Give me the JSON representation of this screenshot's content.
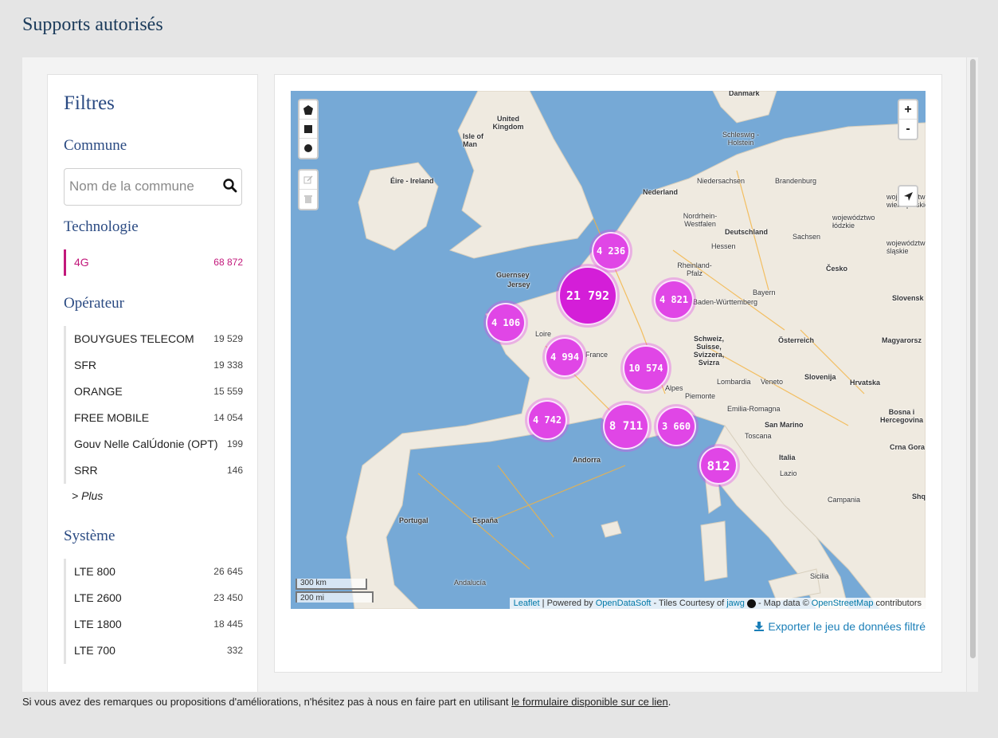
{
  "page": {
    "title": "Supports autorisés"
  },
  "filters": {
    "title": "Filtres",
    "commune": {
      "title": "Commune",
      "search_placeholder": "Nom de la commune"
    },
    "technologie": {
      "title": "Technologie",
      "items": [
        {
          "label": "4G",
          "count": "68 872",
          "active": true
        }
      ]
    },
    "operateur": {
      "title": "Opérateur",
      "items": [
        {
          "label": "BOUYGUES TELECOM",
          "count": "19 529"
        },
        {
          "label": "SFR",
          "count": "19 338"
        },
        {
          "label": "ORANGE",
          "count": "15 559"
        },
        {
          "label": "FREE MOBILE",
          "count": "14 054"
        },
        {
          "label": "Gouv Nelle CalÚdonie (OPT)",
          "count": "199"
        },
        {
          "label": "SRR",
          "count": "146"
        }
      ],
      "more_label": "> Plus"
    },
    "systeme": {
      "title": "Système",
      "items": [
        {
          "label": "LTE 800",
          "count": "26 645"
        },
        {
          "label": "LTE 2600",
          "count": "23 450"
        },
        {
          "label": "LTE 1800",
          "count": "18 445"
        },
        {
          "label": "LTE 700",
          "count": "332"
        }
      ]
    }
  },
  "map": {
    "draw_tools": [
      "polygon-icon",
      "rectangle-icon",
      "circle-icon"
    ],
    "edit_tools": [
      "edit-icon",
      "trash-icon"
    ],
    "zoom_in": "+",
    "zoom_out": "-",
    "clusters": [
      {
        "label": "4 236"
      },
      {
        "label": "21 792"
      },
      {
        "label": "4 821"
      },
      {
        "label": "4 106"
      },
      {
        "label": "4 994"
      },
      {
        "label": "10 574"
      },
      {
        "label": "4 742"
      },
      {
        "label": "8 711"
      },
      {
        "label": "3 660"
      },
      {
        "label": "812"
      }
    ],
    "place_labels": [
      "Danmark",
      "United Kingdom",
      "Isle of Man",
      "Éire - Ireland",
      "Schleswig - Holstein",
      "Nederland",
      "Niedersachsen",
      "Brandenburg",
      "Nordrhein-Westfalen",
      "Deutschland",
      "Hessen",
      "Sachsen",
      "Rheinland-Pfalz",
      "Guernsey",
      "Jersey",
      "Baden-Württemberg",
      "Bayern",
      "Česko",
      "Slovensk",
      "Schweiz, Suisse, Svizzera, Svizra",
      "Österreich",
      "Magyarorsz",
      "Slovenija",
      "Hrvatska",
      "Lombardia",
      "Veneto",
      "Piemonte",
      "Emilia-Romagna",
      "San Marino",
      "Bosna i Hercegovina",
      "Crna Gora",
      "Toscana",
      "Italia",
      "Lazio",
      "Campania",
      "Shqip",
      "Andorra",
      "Portugal",
      "España",
      "Andalucía",
      "Sicilia",
      "Loire",
      "France",
      "Alpes",
      "województwo wielkopolskie",
      "województwo łódzkie",
      "województwo śląskie"
    ],
    "scale": {
      "km": "300 km",
      "mi": "200 mi"
    },
    "attribution": {
      "leaflet": "Leaflet",
      "powered_by": "| Powered by",
      "ods": "OpenDataSoft",
      "tiles": "- Tiles Courtesy of",
      "jawg": "jawg",
      "map_data": "- Map data ©",
      "osm": "OpenStreetMap",
      "contributors": "contributors"
    }
  },
  "export": {
    "label": "Exporter le jeu de données filtré"
  },
  "footer": {
    "text": "Si vous avez des remarques ou propositions d'améliorations, n'hésitez pas à nous en faire part en utilisant",
    "link": "le formulaire disponible sur ce lien",
    "end": "."
  },
  "colors": {
    "accent": "#c2187b",
    "cluster": "#e046e6",
    "heading": "#2a4a82",
    "link": "#1b7fb8"
  }
}
